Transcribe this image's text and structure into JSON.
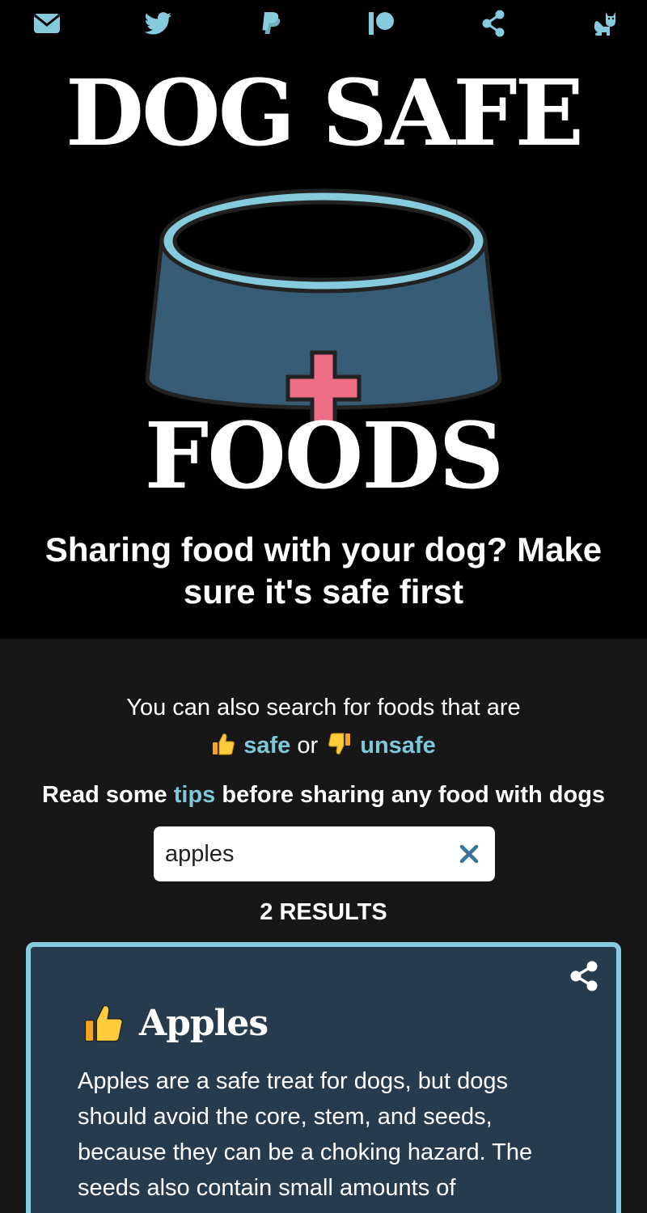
{
  "nav": {
    "icons": [
      "email-icon",
      "twitter-icon",
      "paypal-icon",
      "patreon-icon",
      "share-icon",
      "cat-icon"
    ],
    "icon_color": "#86cbdd"
  },
  "hero": {
    "title_top": "DOG SAFE",
    "title_bottom": "FOODS",
    "tagline": "Sharing food with your dog? Make sure it's safe first"
  },
  "search_hint": {
    "line1": "You can also search for foods that are",
    "safe_label": "safe",
    "or": "or",
    "unsafe_label": "unsafe"
  },
  "tips": {
    "prefix": "Read some",
    "link": "tips",
    "suffix": "before sharing any food with dogs"
  },
  "search": {
    "value": "apples"
  },
  "results": {
    "count_label": "2 RESULTS"
  },
  "card": {
    "title": "Apples",
    "verdict": "safe",
    "description": "Apples are a safe treat for dogs, but dogs should avoid the core, stem, and seeds, because they can be a choking hazard. The seeds also contain small amounts of"
  },
  "colors": {
    "accent": "#7ec8da",
    "card_bg": "#263b4e",
    "card_border": "#86cbdd",
    "page_bg": "#171717",
    "cross": "#ee6e86",
    "bowl": "#365c76"
  }
}
